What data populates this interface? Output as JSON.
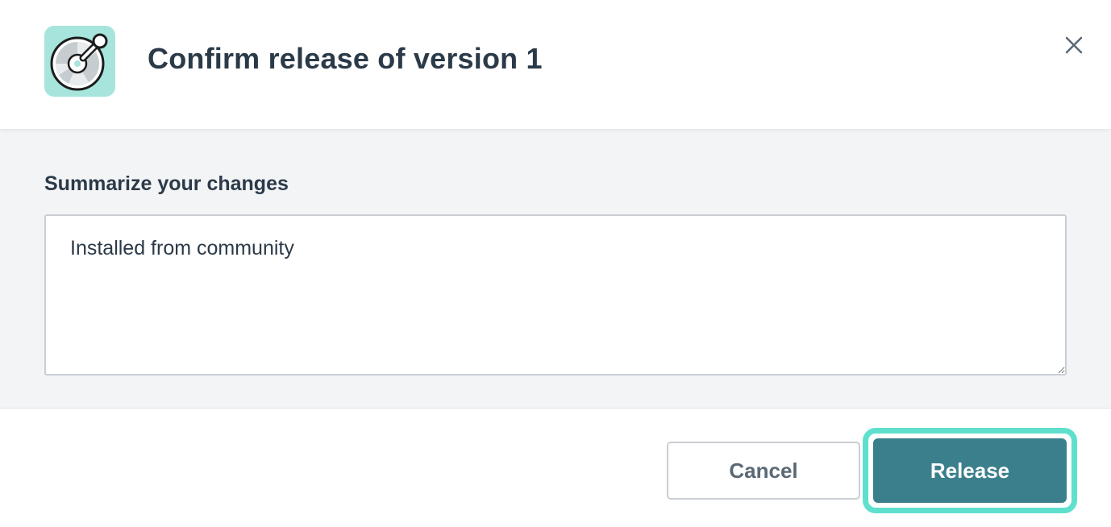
{
  "dialog": {
    "title": "Confirm release of version 1",
    "app_icon": "app-logo-icon",
    "close_icon": "close-icon"
  },
  "form": {
    "label": "Summarize your changes",
    "summary_value": "Installed from community"
  },
  "footer": {
    "cancel_label": "Cancel",
    "release_label": "Release"
  },
  "colors": {
    "icon_bg": "#a7e5dc",
    "primary": "#3b7f8c",
    "focus_ring": "#5fe0cc",
    "text": "#2b3a48",
    "body_bg": "#f3f4f6"
  }
}
